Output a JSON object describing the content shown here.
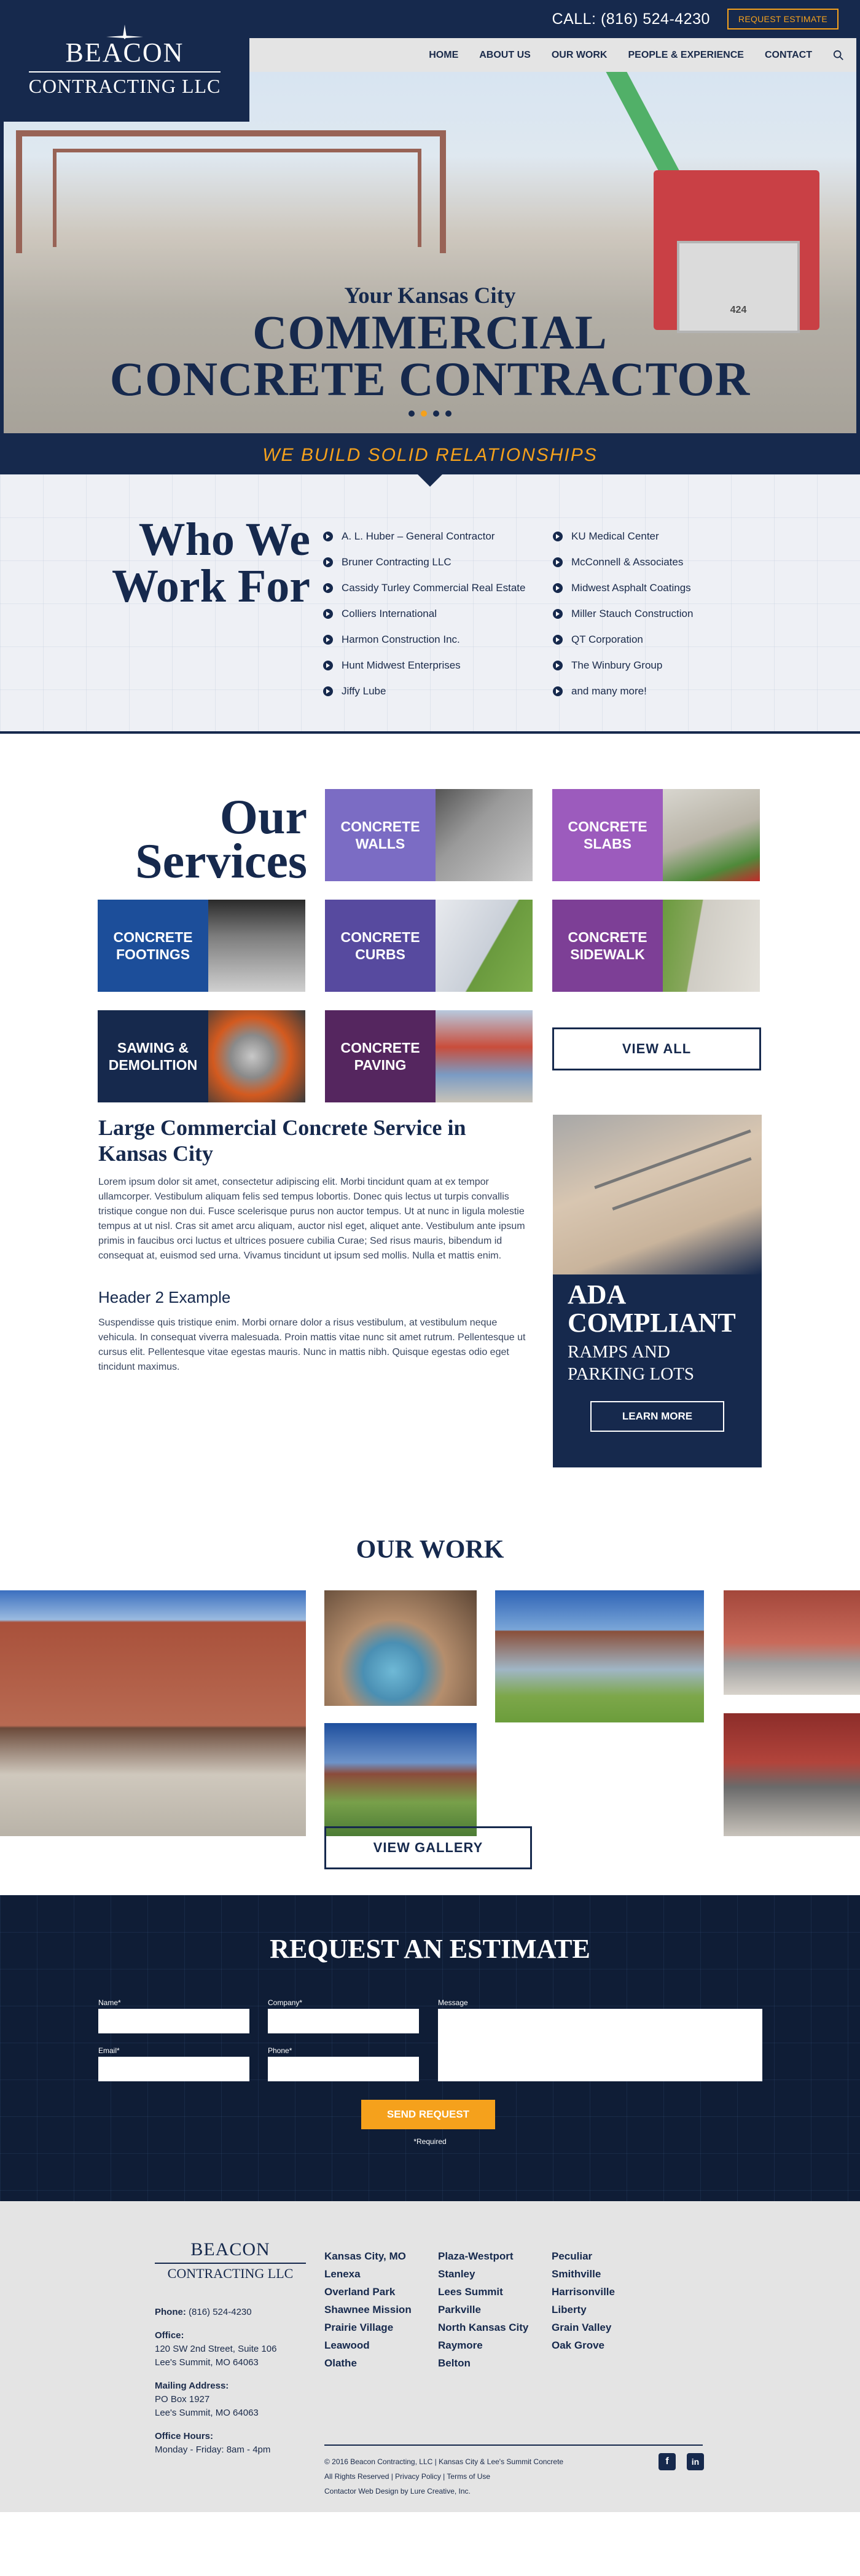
{
  "header": {
    "call": "CALL: (816) 524-4230",
    "request_button": "REQUEST ESTIMATE",
    "logo_line1": "BEACON",
    "logo_line2": "CONTRACTING LLC",
    "nav": [
      "HOME",
      "ABOUT US",
      "OUR WORK",
      "PEOPLE & EXPERIENCE",
      "CONTACT"
    ]
  },
  "hero": {
    "subtitle": "Your Kansas City",
    "title_line1": "COMMERCIAL",
    "title_line2": "CONCRETE CONTRACTOR",
    "slides": 4,
    "active_slide": 2,
    "truck_number": "424",
    "tagline": "WE BUILD SOLID RELATIONSHIPS"
  },
  "who": {
    "title_line1": "Who We",
    "title_line2": "Work For",
    "col1": [
      "A. L. Huber – General Contractor",
      "Bruner Contracting LLC",
      "Cassidy Turley Commercial Real Estate",
      "Colliers International",
      "Harmon Construction Inc.",
      "Hunt Midwest Enterprises",
      "Jiffy Lube"
    ],
    "col2": [
      "KU Medical Center",
      "McConnell & Associates",
      "Midwest Asphalt Coatings",
      "Miller Stauch Construction",
      "QT Corporation",
      "The Winbury Group",
      "and many more!"
    ]
  },
  "services": {
    "title_line1": "Our",
    "title_line2": "Services",
    "tiles": [
      {
        "label": "CONCRETE WALLS",
        "color": "#7b6cc4"
      },
      {
        "label": "CONCRETE SLABS",
        "color": "#9c5bbd"
      },
      {
        "label": "CONCRETE FOOTINGS",
        "color": "#1c4e9a"
      },
      {
        "label": "CONCRETE CURBS",
        "color": "#574a9f"
      },
      {
        "label": "CONCRETE SIDEWALK",
        "color": "#7d3f96"
      },
      {
        "label": "SAWING & DEMOLITION",
        "color": "#16294d"
      },
      {
        "label": "CONCRETE PAVING",
        "color": "#55265f"
      }
    ],
    "view_all": "VIEW ALL"
  },
  "content": {
    "heading": "Large Commercial Concrete Service in Kansas City",
    "para1": "Lorem ipsum dolor sit amet, consectetur adipiscing elit. Morbi tincidunt quam at ex tempor ullamcorper. Vestibulum aliquam felis sed tempus lobortis. Donec quis lectus ut turpis convallis tristique congue non dui. Fusce scelerisque purus non auctor tempus. Ut at nunc in ligula molestie tempus at ut nisl. Cras sit amet arcu aliquam, auctor nisl eget, aliquet ante. Vestibulum ante ipsum primis in faucibus orci luctus et ultrices posuere cubilia Curae; Sed risus mauris, bibendum id consequat at, euismod sed urna. Vivamus tincidunt ut ipsum sed mollis. Nulla et mattis enim.",
    "heading2": "Header 2 Example",
    "para2": "Suspendisse quis tristique enim. Morbi ornare dolor a risus vestibulum, at vestibulum neque vehicula. In consequat viverra malesuada. Proin mattis vitae nunc sit amet rutrum. Pellentesque ut cursus elit. Pellentesque vitae egestas mauris. Nunc in mattis nibh. Quisque egestas odio eget tincidunt maximus.",
    "ada_title_line1": "ADA",
    "ada_title_line2": "COMPLIANT",
    "ada_sub_line1": "RAMPS AND",
    "ada_sub_line2": "PARKING LOTS",
    "ada_button": "LEARN MORE"
  },
  "work": {
    "title": "OUR WORK",
    "gallery_button": "VIEW GALLERY"
  },
  "estimate": {
    "title": "REQUEST AN ESTIMATE",
    "name_label": "Name*",
    "company_label": "Company*",
    "message_label": "Message",
    "email_label": "Email*",
    "phone_label": "Phone*",
    "send_button": "SEND REQUEST",
    "required_note": "*Required"
  },
  "footer": {
    "logo_line1": "BEACON",
    "logo_line2": "CONTRACTING LLC",
    "phone_label": "Phone:",
    "phone": "(816) 524-4230",
    "office_label": "Office:",
    "office_line1": "120 SW 2nd Street, Suite 106",
    "office_line2": "Lee's Summit, MO 64063",
    "mailing_label": "Mailing Address:",
    "mailing_line1": "PO Box 1927",
    "mailing_line2": "Lee's Summit, MO 64063",
    "hours_label": "Office Hours:",
    "hours": "Monday - Friday: 8am - 4pm",
    "cities_col1": [
      "Kansas City, MO",
      "Lenexa",
      "Overland Park",
      "Shawnee Mission",
      "Prairie Village",
      "Leawood",
      "Olathe"
    ],
    "cities_col2": [
      "Plaza-Westport",
      "Stanley",
      "Lees Summit",
      "Parkville",
      "North Kansas City",
      "Raymore",
      "Belton"
    ],
    "cities_col3": [
      "Peculiar",
      "Smithville",
      "Harrisonville",
      "Liberty",
      "Grain Valley",
      "Oak Grove"
    ],
    "legal_line1": "© 2016 Beacon Contracting, LLC | Kansas City & Lee's Summit Concrete",
    "legal_line2": "All Rights Reserved | Privacy Policy | Terms of Use",
    "legal_line3": "Contactor Web Design by Lure Creative, Inc.",
    "facebook_glyph": "f",
    "linkedin_glyph": "in"
  }
}
